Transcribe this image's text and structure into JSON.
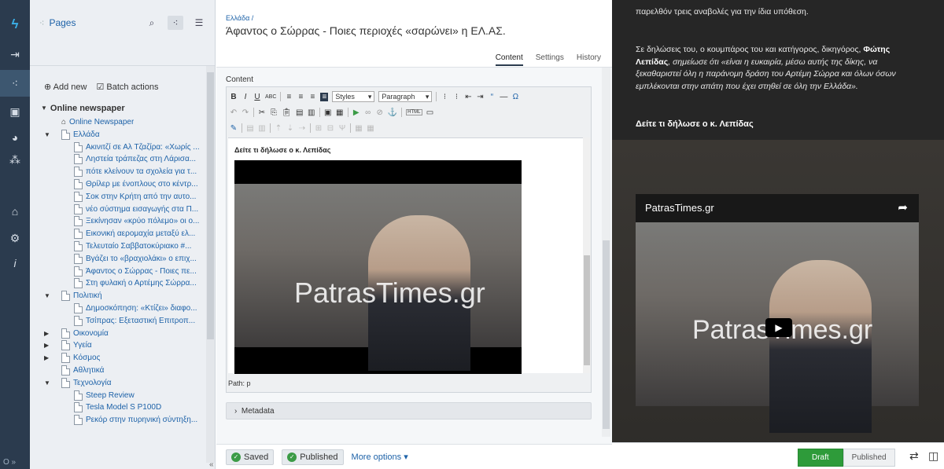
{
  "rail": {
    "icons": [
      "logo-icon",
      "logout-icon",
      "pages-icon",
      "files-icon",
      "reports-icon",
      "security-icon",
      "bank-icon",
      "settings-icon",
      "help-icon"
    ],
    "bottom": "O »"
  },
  "tree": {
    "title": "Pages",
    "add_new": "Add new",
    "batch_actions": "Batch actions",
    "root": "Online newspaper",
    "items": [
      {
        "label": "Online Newspaper",
        "level": 1,
        "twisty": "",
        "kind": "home"
      },
      {
        "label": "Ελλάδα",
        "level": 1,
        "twisty": "▼",
        "kind": "doc"
      },
      {
        "label": "Ακινιτζί σε Αλ Τζαζίρα: «Χωρίς ...",
        "level": 2,
        "twisty": "",
        "kind": "doc"
      },
      {
        "label": "Ληστεία τράπεζας στη Λάρισα...",
        "level": 2,
        "twisty": "",
        "kind": "doc"
      },
      {
        "label": "πότε κλείνουν τα σχολεία για τ...",
        "level": 2,
        "twisty": "",
        "kind": "doc"
      },
      {
        "label": "Θρίλερ με ένοπλους στο κέντρ...",
        "level": 2,
        "twisty": "",
        "kind": "doc"
      },
      {
        "label": "Σοκ στην Κρήτη από την αυτο...",
        "level": 2,
        "twisty": "",
        "kind": "doc"
      },
      {
        "label": "νέο σύστημα εισαγωγής στα Π...",
        "level": 2,
        "twisty": "",
        "kind": "doc"
      },
      {
        "label": "Ξεκίνησαν «κρύο πόλεμο» οι ο...",
        "level": 2,
        "twisty": "",
        "kind": "doc"
      },
      {
        "label": "Εικονική αερομαχία μεταξύ ελ...",
        "level": 2,
        "twisty": "",
        "kind": "doc"
      },
      {
        "label": "Τελευταίο Σαββατοκύριακο #...",
        "level": 2,
        "twisty": "",
        "kind": "doc"
      },
      {
        "label": "Βγάζει το «βραχιολάκι» ο επιχ...",
        "level": 2,
        "twisty": "",
        "kind": "doc"
      },
      {
        "label": "Άφαντος ο Σώρρας - Ποιες πε...",
        "level": 2,
        "twisty": "",
        "kind": "doc"
      },
      {
        "label": "Στη φυλακή ο Αρτέμης Σώρρα...",
        "level": 2,
        "twisty": "",
        "kind": "doc"
      },
      {
        "label": "Πολιτική",
        "level": 1,
        "twisty": "▼",
        "kind": "doc"
      },
      {
        "label": "Δημοσκόπηση: «Κτίζει» διαφο...",
        "level": 2,
        "twisty": "",
        "kind": "doc"
      },
      {
        "label": "Τσίπρας: Εξεταστική Επιτροπ...",
        "level": 2,
        "twisty": "",
        "kind": "doc"
      },
      {
        "label": "Οικονομία",
        "level": 1,
        "twisty": "▶",
        "kind": "doc"
      },
      {
        "label": "Υγεία",
        "level": 1,
        "twisty": "▶",
        "kind": "doc"
      },
      {
        "label": "Κόσμος",
        "level": 1,
        "twisty": "▶",
        "kind": "doc"
      },
      {
        "label": "Αθλητικά",
        "level": 1,
        "twisty": "",
        "kind": "doc"
      },
      {
        "label": "Τεχνολογία",
        "level": 1,
        "twisty": "▼",
        "kind": "doc"
      },
      {
        "label": "Steep Review",
        "level": 2,
        "twisty": "",
        "kind": "doc"
      },
      {
        "label": "Tesla Model S P100D",
        "level": 2,
        "twisty": "",
        "kind": "doc"
      },
      {
        "label": "Ρεκόρ στην πυρηνική σύντηξη...",
        "level": 2,
        "twisty": "",
        "kind": "doc"
      }
    ],
    "collapse": "«"
  },
  "editor": {
    "breadcrumb": "Ελλάδα /",
    "title": "Άφαντος ο Σώρρας - Ποιες περιοχές «σαρώνει» η ΕΛ.ΑΣ.",
    "tabs": [
      "Content",
      "Settings",
      "History"
    ],
    "content_label": "Content",
    "styles_dropdown": "Styles",
    "format_dropdown": "Paragraph",
    "body_heading": "Δείτε τι δήλωσε ο κ. Λεπίδας",
    "video_watermark": "PatrasTimes.gr",
    "path": "Path: p",
    "metadata": "Metadata",
    "saved": "Saved",
    "published": "Published",
    "more_options": "More options"
  },
  "preview": {
    "para1": "παρελθόν τρεις αναβολές για την ίδια υπόθεση.",
    "para2_a": "Σε δηλώσεις του, ο κουμπάρος του και κατήγορος, δικηγόρος, ",
    "para2_b": "Φώτης Λεπίδας",
    "para2_c": ", σημείωσε ότι «είναι η ευκαιρία, μέσω αυτής της δίκης, να ξεκαθαριστεί όλη η παράνομη δράση του Αρτέμη Σώρρα και όλων όσων εμπλέκονται στην απάτη που έχει στηθεί σε όλη την Ελλάδα».",
    "heading": "Δείτε τι δήλωσε ο κ. Λεπίδας",
    "video_channel": "PatrasTimes.gr",
    "video_watermark": "PatrasTimes.gr",
    "draft": "Draft",
    "published": "Published"
  },
  "colors": {
    "rail": "#2b3b4e",
    "accent": "#1d62a8",
    "draft_green": "#2e9b3a"
  }
}
